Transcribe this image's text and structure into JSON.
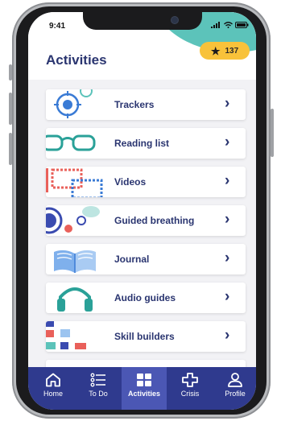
{
  "status_bar": {
    "time": "9:41",
    "signal_icon": "signal-icon",
    "wifi_icon": "wifi-icon",
    "battery_icon": "battery-icon"
  },
  "header": {
    "title": "Activities",
    "points": "137",
    "points_icon": "star-icon",
    "accent_color": "#5cc3ba"
  },
  "activities": [
    {
      "label": "Trackers",
      "icon": "target-icon"
    },
    {
      "label": "Reading list",
      "icon": "glasses-icon"
    },
    {
      "label": "Videos",
      "icon": "film-frames-icon"
    },
    {
      "label": "Guided breathing",
      "icon": "breathing-bubbles-icon"
    },
    {
      "label": "Journal",
      "icon": "open-book-icon"
    },
    {
      "label": "Audio guides",
      "icon": "headphones-icon"
    },
    {
      "label": "Skill builders",
      "icon": "blocks-icon"
    }
  ],
  "tabs": [
    {
      "label": "Home",
      "icon": "home-icon",
      "active": false
    },
    {
      "label": "To Do",
      "icon": "checklist-icon",
      "active": false
    },
    {
      "label": "Activities",
      "icon": "grid-icon",
      "active": true
    },
    {
      "label": "Crisis",
      "icon": "cross-icon",
      "active": false
    },
    {
      "label": "Profile",
      "icon": "person-icon",
      "active": false
    }
  ],
  "colors": {
    "primary": "#2a3570",
    "tab_bar": "#2f3a8e",
    "tab_active": "#4b57b4",
    "badge": "#f8c23a"
  }
}
